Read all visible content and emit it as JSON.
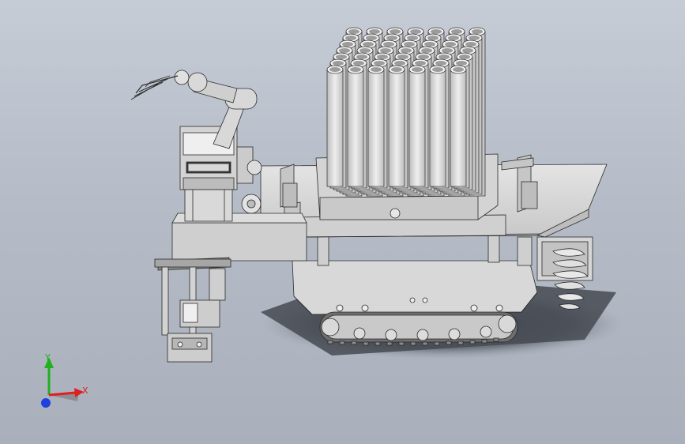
{
  "viewport": {
    "background_top": "#c6ccd6",
    "background_bottom": "#a9b0bb"
  },
  "model": {
    "body_fill": "#d9d9d9",
    "edge_color": "#2a2a2a",
    "shadow_color": "#3b3f47",
    "tube_count": 49,
    "tube_grid": "7x7"
  },
  "triad": {
    "x_label": "X",
    "y_label": "Y",
    "x_color": "#e02020",
    "y_color": "#20b020",
    "z_color": "#2040e0"
  }
}
